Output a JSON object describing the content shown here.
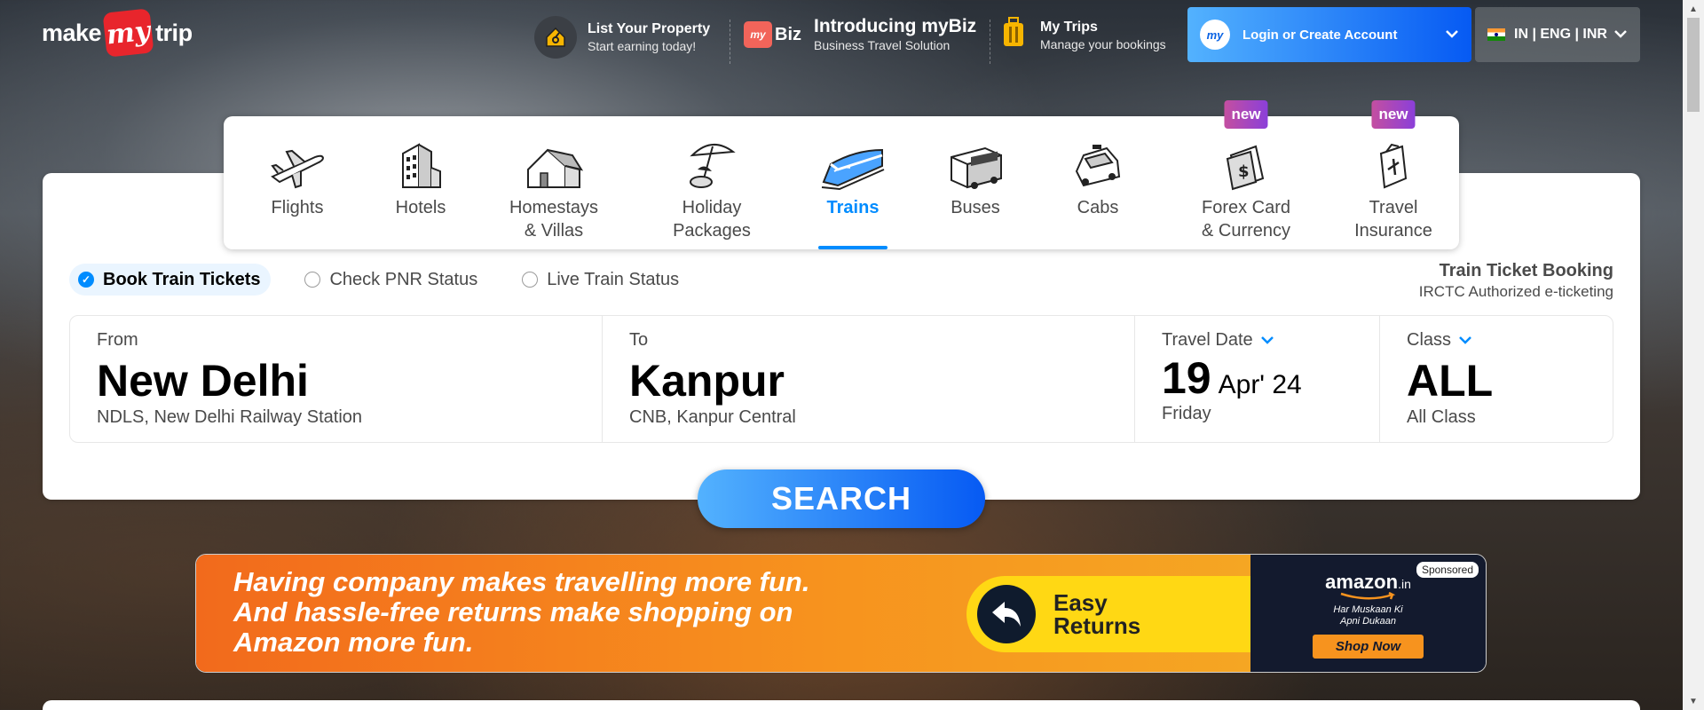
{
  "header": {
    "logo": {
      "word1": "make",
      "mark": "my",
      "word2": "trip"
    },
    "list_property": {
      "title": "List Your Property",
      "subtitle": "Start earning today!"
    },
    "mybiz": {
      "badge": "Biz",
      "title": "Introducing myBiz",
      "subtitle": "Business Travel Solution"
    },
    "my_trips": {
      "title": "My Trips",
      "subtitle": "Manage your bookings"
    },
    "login_label": "Login or Create Account",
    "login_icon_text": "my",
    "locale_label": "IN | ENG | INR"
  },
  "nav": {
    "items": [
      {
        "label": "Flights",
        "icon": "flight-icon"
      },
      {
        "label": "Hotels",
        "icon": "hotel-icon"
      },
      {
        "label": "Homestays\n& Villas",
        "icon": "homestay-icon"
      },
      {
        "label": "Holiday\nPackages",
        "icon": "holiday-icon"
      },
      {
        "label": "Trains",
        "icon": "train-icon",
        "active": true
      },
      {
        "label": "Buses",
        "icon": "bus-icon"
      },
      {
        "label": "Cabs",
        "icon": "cab-icon"
      },
      {
        "label": "Forex Card\n& Currency",
        "icon": "forex-icon",
        "badge": "new"
      },
      {
        "label": "Travel\nInsurance",
        "icon": "insurance-icon",
        "badge": "new"
      }
    ]
  },
  "radios": [
    {
      "label": "Book Train Tickets",
      "selected": true
    },
    {
      "label": "Check PNR Status",
      "selected": false
    },
    {
      "label": "Live Train Status",
      "selected": false
    }
  ],
  "booking_info": {
    "title": "Train Ticket Booking",
    "subtitle": "IRCTC Authorized e-ticketing"
  },
  "search": {
    "from": {
      "label": "From",
      "value": "New Delhi",
      "detail": "NDLS, New Delhi Railway Station"
    },
    "to": {
      "label": "To",
      "value": "Kanpur",
      "detail": "CNB, Kanpur Central"
    },
    "date": {
      "label": "Travel Date",
      "day": "19",
      "month_year": "Apr' 24",
      "weekday": "Friday"
    },
    "class": {
      "label": "Class",
      "value": "ALL",
      "detail": "All Class"
    },
    "button_label": "SEARCH"
  },
  "ad": {
    "text": [
      "Having company makes travelling more fun.",
      "And hassle-free returns make shopping on",
      "Amazon more fun."
    ],
    "pill_text": [
      "Easy",
      "Returns"
    ],
    "sponsored": "Sponsored",
    "brand": "amazon",
    "brand_suffix": ".in",
    "tagline": [
      "Har Muskaan Ki",
      "Apni Dukaan"
    ],
    "cta": "Shop Now"
  },
  "colors": {
    "accent": "#008cff",
    "brand_red": "#e8252c",
    "gradient_start": "#53b2fe",
    "gradient_end": "#065af3"
  }
}
